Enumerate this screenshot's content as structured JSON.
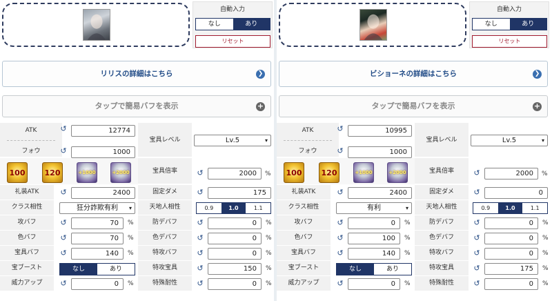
{
  "auto_input_label": "自動入力",
  "toggle_none": "なし",
  "toggle_yes": "あり",
  "reset_label": "リセット",
  "buff_button_label": "タップで簡易バフを表示",
  "labels": {
    "atk": "ATK",
    "fou": "フォウ",
    "np_level": "宝具レベル",
    "np_multiplier": "宝具倍率",
    "ce_atk": "礼装ATK",
    "fixed_damage": "固定ダメ",
    "class_affinity": "クラス相性",
    "attribute_affinity": "天地人相性",
    "atk_buff": "攻バフ",
    "def_debuff": "防デバフ",
    "card_buff": "色バフ",
    "card_debuff": "色デバフ",
    "np_buff": "宝具バフ",
    "special_atk_buff": "特攻バフ",
    "np_boost": "宝ブースト",
    "special_np": "特攻宝具",
    "power_up": "威力アップ",
    "special_resist": "特殊耐性"
  },
  "percent": "%",
  "undo_glyph": "↺",
  "chevron_glyph": "❯",
  "select_chevron": "▾",
  "plus_glyph": "+",
  "affinity_options": [
    "0.9",
    "1.0",
    "1.1"
  ],
  "badges": [
    "100",
    "120",
    "+1000",
    "+2000"
  ],
  "panels": [
    {
      "detail_label": "リリスの詳細はこちら",
      "auto_selected": "yes",
      "atk": "12774",
      "fou": "1000",
      "np_level": "Lv.5",
      "np_multiplier": "2000",
      "ce_atk": "2400",
      "fixed_damage": "175",
      "class_affinity": "狂分詐欺有利",
      "attribute_affinity_selected": "1.0",
      "atk_buff": "70",
      "def_debuff": "0",
      "card_buff": "70",
      "card_debuff": "0",
      "np_buff": "140",
      "special_atk_buff": "0",
      "np_boost_selected": "none",
      "special_np": "150",
      "power_up": "0",
      "special_resist": "0"
    },
    {
      "detail_label": "ビショーネの詳細はこちら",
      "auto_selected": "yes",
      "atk": "10995",
      "fou": "1000",
      "np_level": "Lv.5",
      "np_multiplier": "2000",
      "ce_atk": "2400",
      "fixed_damage": "0",
      "class_affinity": "有利",
      "attribute_affinity_selected": "1.0",
      "atk_buff": "0",
      "def_debuff": "0",
      "card_buff": "100",
      "card_debuff": "0",
      "np_buff": "140",
      "special_atk_buff": "0",
      "np_boost_selected": "none",
      "special_np": "175",
      "power_up": "0",
      "special_resist": "0"
    }
  ]
}
